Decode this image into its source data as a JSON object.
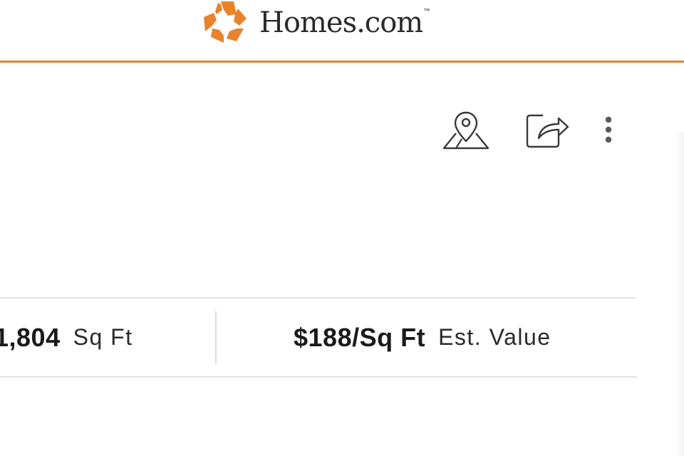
{
  "header": {
    "brand_name": "Homes.com",
    "trademark": "™",
    "brand_color": "#E8822D",
    "logo_icon": "homes-star-icon"
  },
  "actions": {
    "map_icon": "map-pin-icon",
    "share_icon": "share-icon",
    "more_icon": "more-vertical-icon"
  },
  "stats": {
    "sqft_value": "1,804",
    "sqft_label": "Sq Ft",
    "price_per_sqft_value": "$188/Sq Ft",
    "price_per_sqft_label": "Est. Value"
  }
}
